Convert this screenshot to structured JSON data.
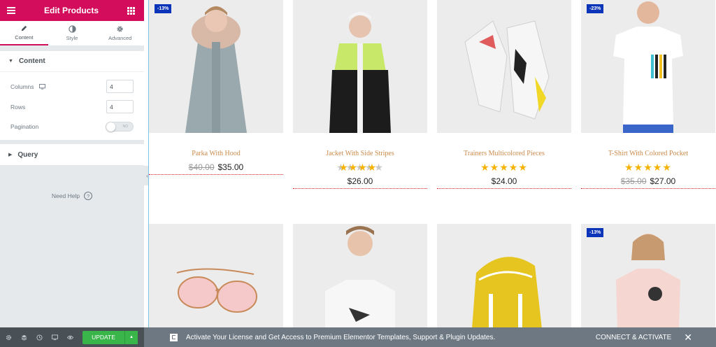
{
  "panel": {
    "title": "Edit Products",
    "tabs": [
      {
        "label": "Content",
        "icon": "pencil-icon"
      },
      {
        "label": "Style",
        "icon": "contrast-icon"
      },
      {
        "label": "Advanced",
        "icon": "gear-icon"
      }
    ],
    "content_section": "Content",
    "columns_label": "Columns",
    "columns_value": "4",
    "rows_label": "Rows",
    "rows_value": "4",
    "pagination_label": "Pagination",
    "pagination_toggle": "NO",
    "query_section": "Query",
    "need_help": "Need Help",
    "help_glyph": "?"
  },
  "products": [
    {
      "name": "Parka With Hood",
      "badge": "-13%",
      "old_price": "$40.00",
      "price": "$35.00",
      "stars": "",
      "rating": 0
    },
    {
      "name": "Jacket With Side Stripes",
      "badge": "",
      "old_price": "",
      "price": "$26.00",
      "stars": "★★★★★",
      "rating": 4.5
    },
    {
      "name": "Trainers Multicolored Pieces",
      "badge": "",
      "old_price": "",
      "price": "$24.00",
      "stars": "★★★★★",
      "rating": 5
    },
    {
      "name": "T-Shirt With Colored Pocket",
      "badge": "-23%",
      "old_price": "$35.00",
      "price": "$27.00",
      "stars": "★★★★★",
      "rating": 5
    },
    {
      "name": "",
      "badge": "",
      "image": "sunglasses"
    },
    {
      "name": "",
      "badge": "",
      "image": "printed-tshirt"
    },
    {
      "name": "",
      "badge": "",
      "image": "yellow-backpack"
    },
    {
      "name": "",
      "badge": "-13%",
      "image": "pink-tshirt"
    }
  ],
  "footer": {
    "update_label": "UPDATE",
    "update_arrow": "▲",
    "notice": "Activate Your License and Get Access to Premium Elementor Templates, Support & Plugin Updates.",
    "connect": "CONNECT & ACTIVATE",
    "close": "✕"
  },
  "colors": {
    "brand": "#d30c5c",
    "badge": "#0b34b8",
    "star": "#f5b300",
    "product_name": "#cb8a4b",
    "update": "#39b54a"
  }
}
